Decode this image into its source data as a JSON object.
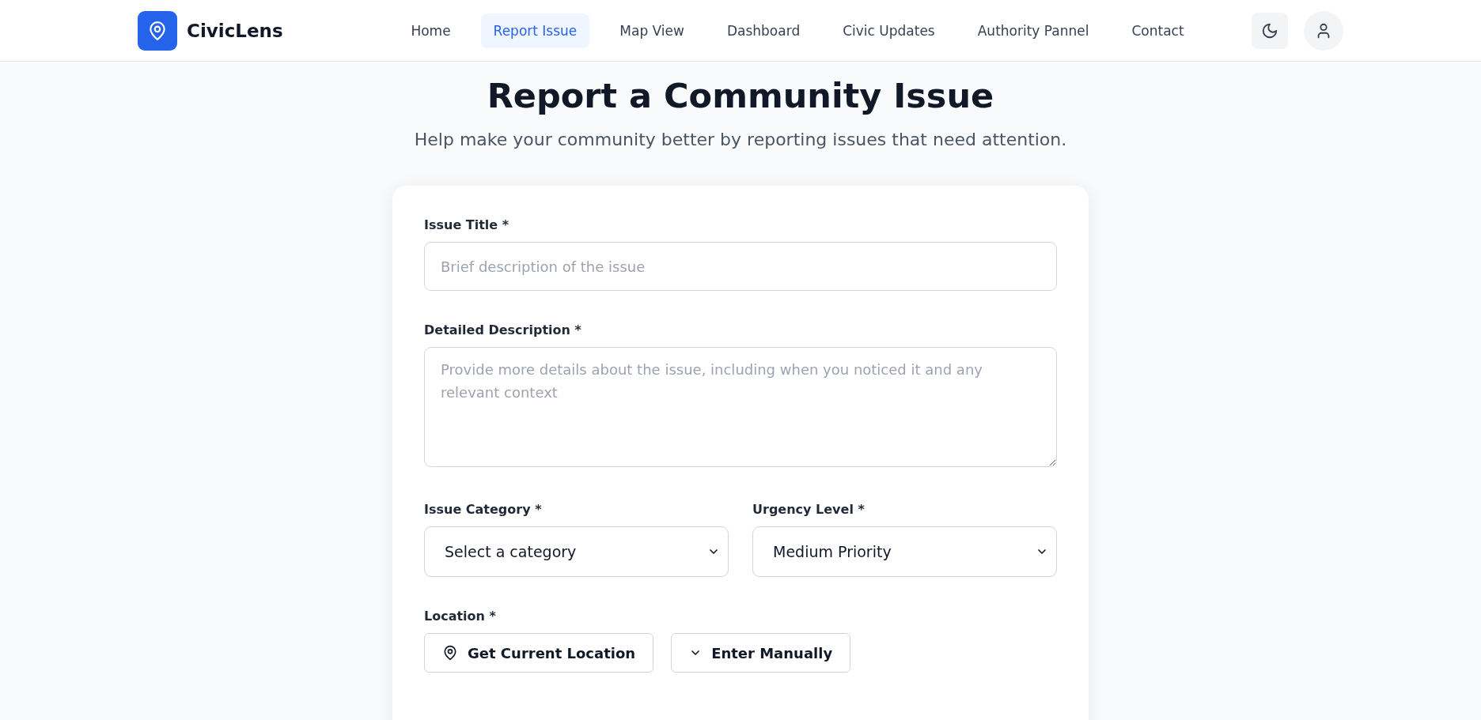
{
  "brand": {
    "name": "CivicLens"
  },
  "nav": [
    {
      "label": "Home",
      "selected": false
    },
    {
      "label": "Report Issue",
      "selected": true
    },
    {
      "label": "Map View",
      "selected": false
    },
    {
      "label": "Dashboard",
      "selected": false
    },
    {
      "label": "Civic Updates",
      "selected": false
    },
    {
      "label": "Authority Pannel",
      "selected": false
    },
    {
      "label": "Contact",
      "selected": false
    }
  ],
  "page": {
    "title": "Report a Community Issue",
    "subtitle": "Help make your community better by reporting issues that need attention."
  },
  "form": {
    "title_field": {
      "label": "Issue Title *",
      "placeholder": "Brief description of the issue"
    },
    "description_field": {
      "label": "Detailed Description *",
      "placeholder": "Provide more details about the issue, including when you noticed it and any relevant context"
    },
    "selects": [
      {
        "label": "Issue Category *",
        "value": "Select a category"
      },
      {
        "label": "Urgency Level *",
        "value": "Medium Priority"
      }
    ],
    "location": {
      "label": "Location *",
      "buttons": [
        {
          "kind": "pin",
          "label": "Get Current Location"
        },
        {
          "kind": "chevron",
          "label": "Enter Manually"
        }
      ]
    }
  }
}
